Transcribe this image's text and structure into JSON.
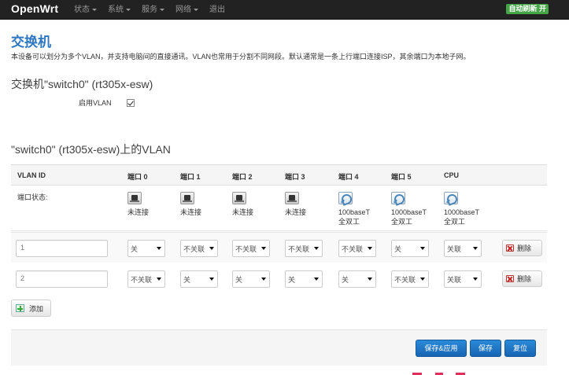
{
  "navbar": {
    "brand": "OpenWrt",
    "menu": [
      {
        "label": "状态",
        "dropdown": true
      },
      {
        "label": "系统",
        "dropdown": true
      },
      {
        "label": "服务",
        "dropdown": true
      },
      {
        "label": "网络",
        "dropdown": true
      },
      {
        "label": "退出",
        "dropdown": false
      }
    ],
    "auto_refresh": "自动刷新 开",
    "auto_refresh_color": "#46a546"
  },
  "page": {
    "title": "交换机",
    "description": "本设备可以划分为多个VLAN，并支持电脑间的直接通讯。VLAN也常用于分割不同网段。默认通常是一条上行端口连接ISP，其余端口为本地子网。",
    "title_color": "#2d76c0"
  },
  "switch_section": {
    "title": "交换机\"switch0\" (rt305x-esw)",
    "enable_vlan_label": "启用VLAN",
    "enable_vlan_checked": true
  },
  "vlan_section": {
    "title": "\"switch0\" (rt305x-esw)上的VLAN",
    "headers": [
      "VLAN ID",
      "端口 0",
      "端口 1",
      "端口 2",
      "端口 3",
      "端口 4",
      "端口 5",
      "CPU"
    ],
    "status_label": "端口状态:",
    "port_status": [
      {
        "icon": "ethernet-port-down-icon",
        "line1": "未连接",
        "line2": ""
      },
      {
        "icon": "ethernet-port-down-icon",
        "line1": "未连接",
        "line2": ""
      },
      {
        "icon": "ethernet-port-down-icon",
        "line1": "未连接",
        "line2": ""
      },
      {
        "icon": "ethernet-port-down-icon",
        "line1": "未连接",
        "line2": ""
      },
      {
        "icon": "ethernet-port-up-icon",
        "line1": "100baseT",
        "line2": "全双工"
      },
      {
        "icon": "ethernet-port-up-icon",
        "line1": "1000baseT",
        "line2": "全双工"
      },
      {
        "icon": "ethernet-port-up-icon",
        "line1": "1000baseT",
        "line2": "全双工"
      }
    ],
    "rows": [
      {
        "vlan_id": "1",
        "ports": [
          "关",
          "不关联",
          "不关联",
          "不关联",
          "不关联",
          "关",
          "关联"
        ],
        "delete_label": "删除"
      },
      {
        "vlan_id": "2",
        "ports": [
          "不关联",
          "关",
          "关",
          "关",
          "关",
          "不关联",
          "关联"
        ],
        "delete_label": "删除"
      }
    ],
    "add_label": "添加"
  },
  "footer": {
    "save_apply": "保存&应用",
    "save": "保存",
    "reset": "复位",
    "button_color": "#1f77c8"
  }
}
